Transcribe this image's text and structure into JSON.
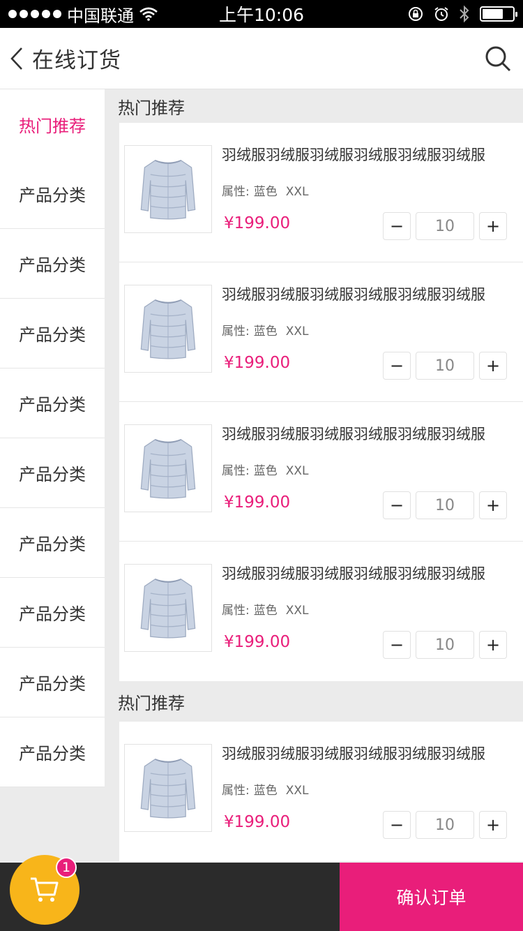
{
  "status_bar": {
    "carrier": "中国联通",
    "time": "上午10:06",
    "battery_level": 0.68
  },
  "header": {
    "title": "在线订货"
  },
  "sidebar": {
    "items": [
      {
        "label": "热门推荐",
        "active": true
      },
      {
        "label": "产品分类"
      },
      {
        "label": "产品分类"
      },
      {
        "label": "产品分类"
      },
      {
        "label": "产品分类"
      },
      {
        "label": "产品分类"
      },
      {
        "label": "产品分类"
      },
      {
        "label": "产品分类"
      },
      {
        "label": "产品分类"
      },
      {
        "label": "产品分类"
      }
    ]
  },
  "sections": [
    {
      "title": "热门推荐",
      "products": [
        {
          "name": "羽绒服羽绒服羽绒服羽绒服羽绒服羽绒服",
          "attr_label": "属性:",
          "color": "蓝色",
          "size": "XXL",
          "price": "¥199.00",
          "qty": "10",
          "minus": "−",
          "plus": "+"
        },
        {
          "name": "羽绒服羽绒服羽绒服羽绒服羽绒服羽绒服",
          "attr_label": "属性:",
          "color": "蓝色",
          "size": "XXL",
          "price": "¥199.00",
          "qty": "10",
          "minus": "−",
          "plus": "+"
        },
        {
          "name": "羽绒服羽绒服羽绒服羽绒服羽绒服羽绒服",
          "attr_label": "属性:",
          "color": "蓝色",
          "size": "XXL",
          "price": "¥199.00",
          "qty": "10",
          "minus": "−",
          "plus": "+"
        },
        {
          "name": "羽绒服羽绒服羽绒服羽绒服羽绒服羽绒服",
          "attr_label": "属性:",
          "color": "蓝色",
          "size": "XXL",
          "price": "¥199.00",
          "qty": "10",
          "minus": "−",
          "plus": "+"
        }
      ]
    },
    {
      "title": "热门推荐",
      "products": [
        {
          "name": "羽绒服羽绒服羽绒服羽绒服羽绒服羽绒服",
          "attr_label": "属性:",
          "color": "蓝色",
          "size": "XXL",
          "price": "¥199.00",
          "qty": "10",
          "minus": "−",
          "plus": "+"
        }
      ]
    }
  ],
  "bottom_bar": {
    "cart_count": "1",
    "confirm_label": "确认订单"
  },
  "colors": {
    "accent": "#e91e7a",
    "cart": "#f8b51a",
    "bottom_bar": "#2b2b2b"
  },
  "icons": [
    "signal-dots-icon",
    "wifi-icon",
    "lock-rotation-icon",
    "alarm-icon",
    "bluetooth-icon",
    "battery-icon",
    "back-chevron-icon",
    "search-icon",
    "jacket-image",
    "cart-icon"
  ]
}
